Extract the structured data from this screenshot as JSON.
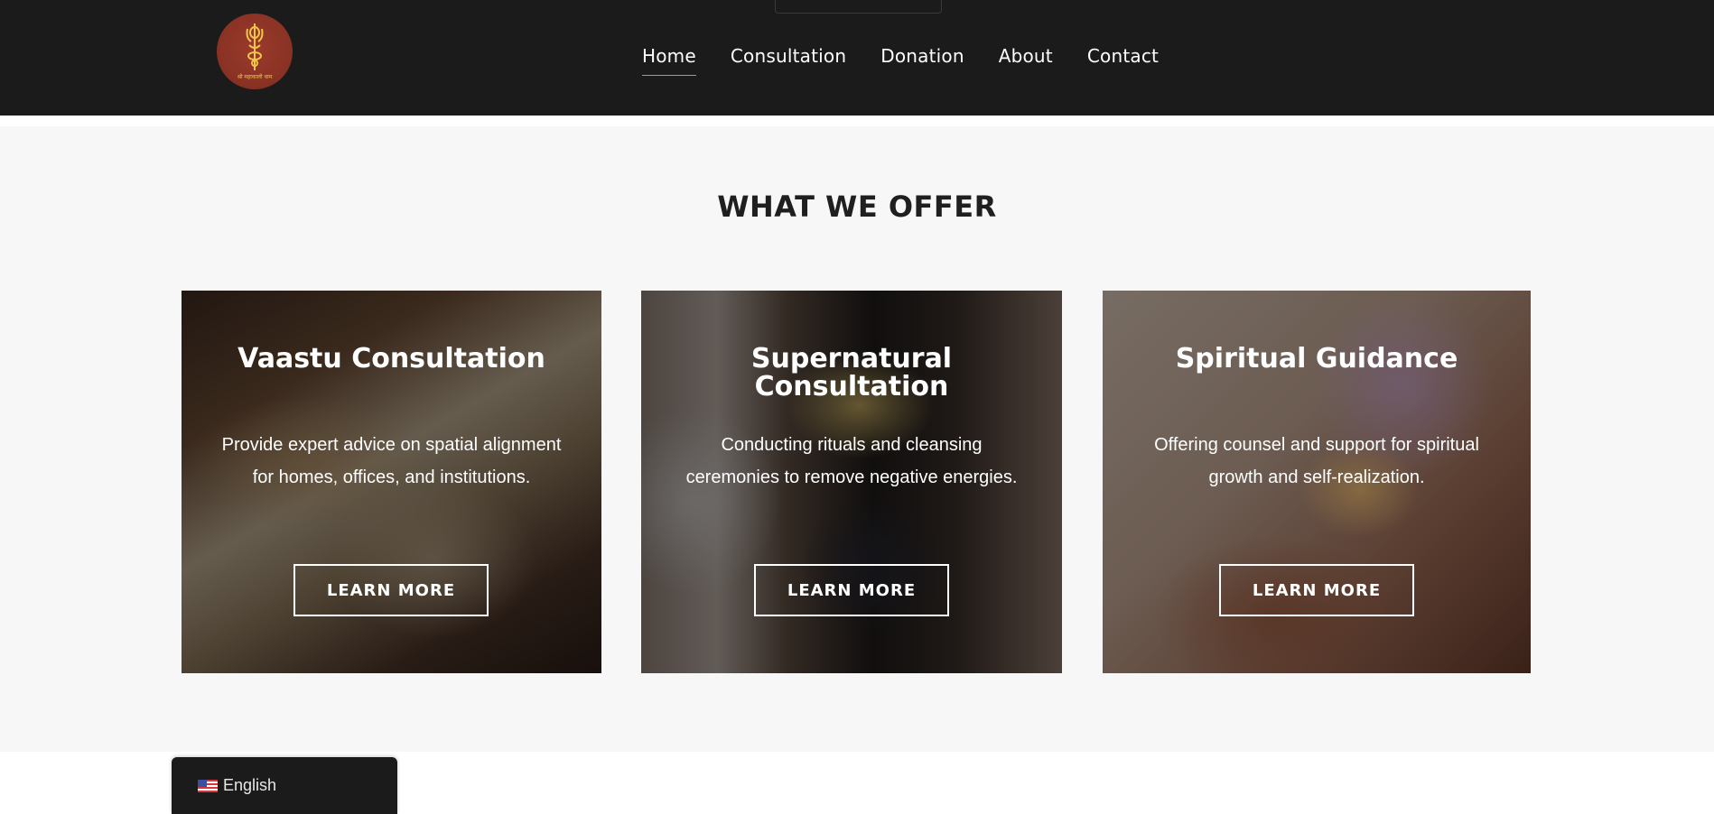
{
  "brand": {
    "logo_text": "श्री महाकाली धाम",
    "logo_bg_color": "#8b3325",
    "logo_accent_color": "#f0c64a"
  },
  "nav": {
    "items": [
      {
        "label": "Home",
        "active": true
      },
      {
        "label": "Consultation",
        "active": false
      },
      {
        "label": "Donation",
        "active": false
      },
      {
        "label": "About",
        "active": false
      },
      {
        "label": "Contact",
        "active": false
      }
    ]
  },
  "offer": {
    "title": "WHAT WE OFFER",
    "cards": [
      {
        "title": "Vaastu Consultation",
        "description": "Provide expert advice on spatial alignment for homes, offices, and institutions.",
        "button_label": "LEARN MORE"
      },
      {
        "title": "Supernatural Consultation",
        "description": "Conducting rituals and cleansing ceremonies to remove negative energies.",
        "button_label": "LEARN MORE"
      },
      {
        "title": "Spiritual Guidance",
        "description": "Offering counsel and support for spiritual growth and self-realization.",
        "button_label": "LEARN MORE"
      }
    ]
  },
  "language_switcher": {
    "label": "English",
    "flag_icon": "us-flag-icon"
  },
  "colors": {
    "header_bg": "#1b1b1b",
    "section_bg": "#f7f7f7",
    "title_color": "#1f1f1f"
  }
}
